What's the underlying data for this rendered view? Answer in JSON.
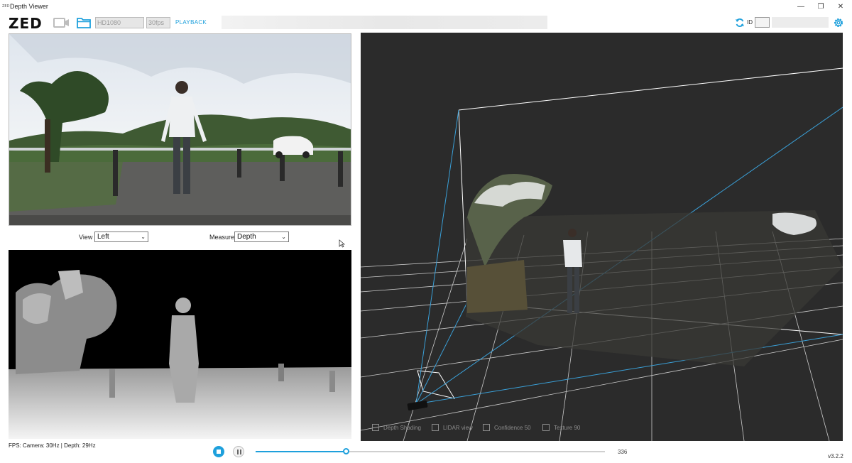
{
  "window": {
    "app_icon_text": "ZED",
    "title": "Depth Viewer",
    "minimize": "—",
    "restore": "❐",
    "close": "✕"
  },
  "toolbar": {
    "logo": "ZED",
    "camera_icon": "camera-icon",
    "folder_icon": "folder-icon",
    "resolution_value": "HD1080",
    "fps_value": "30fps",
    "playback_label": "PLAYBACK",
    "refresh_icon": "refresh-icon",
    "id_label": "ID",
    "id_value": "",
    "settings_icon": "gear-icon"
  },
  "controls": {
    "view_label": "View",
    "view_selected": "Left",
    "measure_label": "Measure",
    "measure_selected": "Depth"
  },
  "viewer3d": {
    "options": [
      {
        "label": "Depth Shading",
        "checked": false
      },
      {
        "label": "LIDAR view",
        "checked": false
      },
      {
        "label": "Confidence 50",
        "checked": false
      },
      {
        "label": "Texture 90",
        "checked": false
      }
    ]
  },
  "status": {
    "fps_text": "FPS: Camera: 30Hz | Depth: 29Hz",
    "frame_count": "336",
    "playback_progress": 0.26,
    "version": "v3.2.2"
  },
  "colors": {
    "accent": "#1ea0dc",
    "viewer_bg": "#2b2b2b"
  }
}
